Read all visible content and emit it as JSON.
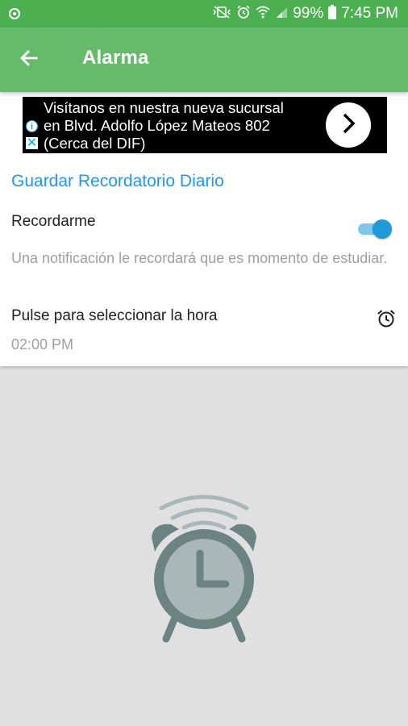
{
  "status_bar": {
    "battery": "99%",
    "time": "7:45 PM"
  },
  "toolbar": {
    "title": "Alarma"
  },
  "ad": {
    "line1": "Visítanos en nuestra nueva sucursal",
    "line2": "en Blvd. Adolfo López Mateos 802",
    "line3": "(Cerca del DIF)",
    "info_glyph": "i",
    "close_glyph": "✕"
  },
  "card": {
    "section_title": "Guardar Recordatorio Diario",
    "remind_label": "Recordarme",
    "remind_enabled": true,
    "remind_description": "Una notificación le recordará que es momento de estudiar.",
    "time_label": "Pulse para seleccionar la hora",
    "time_value": "02:00 PM"
  },
  "colors": {
    "status_bar": "#4caf50",
    "toolbar": "#66bb6a",
    "accent": "#2196f3",
    "switch_thumb": "#1e9ad6",
    "switch_track": "#7cc8ec",
    "background": "#e0e0e0",
    "illustration": "#6b8482"
  },
  "icons": {
    "back": "arrow-left-icon",
    "alarm_small": "alarm-clock-icon",
    "illustration": "ringing-alarm-clock-illustration"
  }
}
